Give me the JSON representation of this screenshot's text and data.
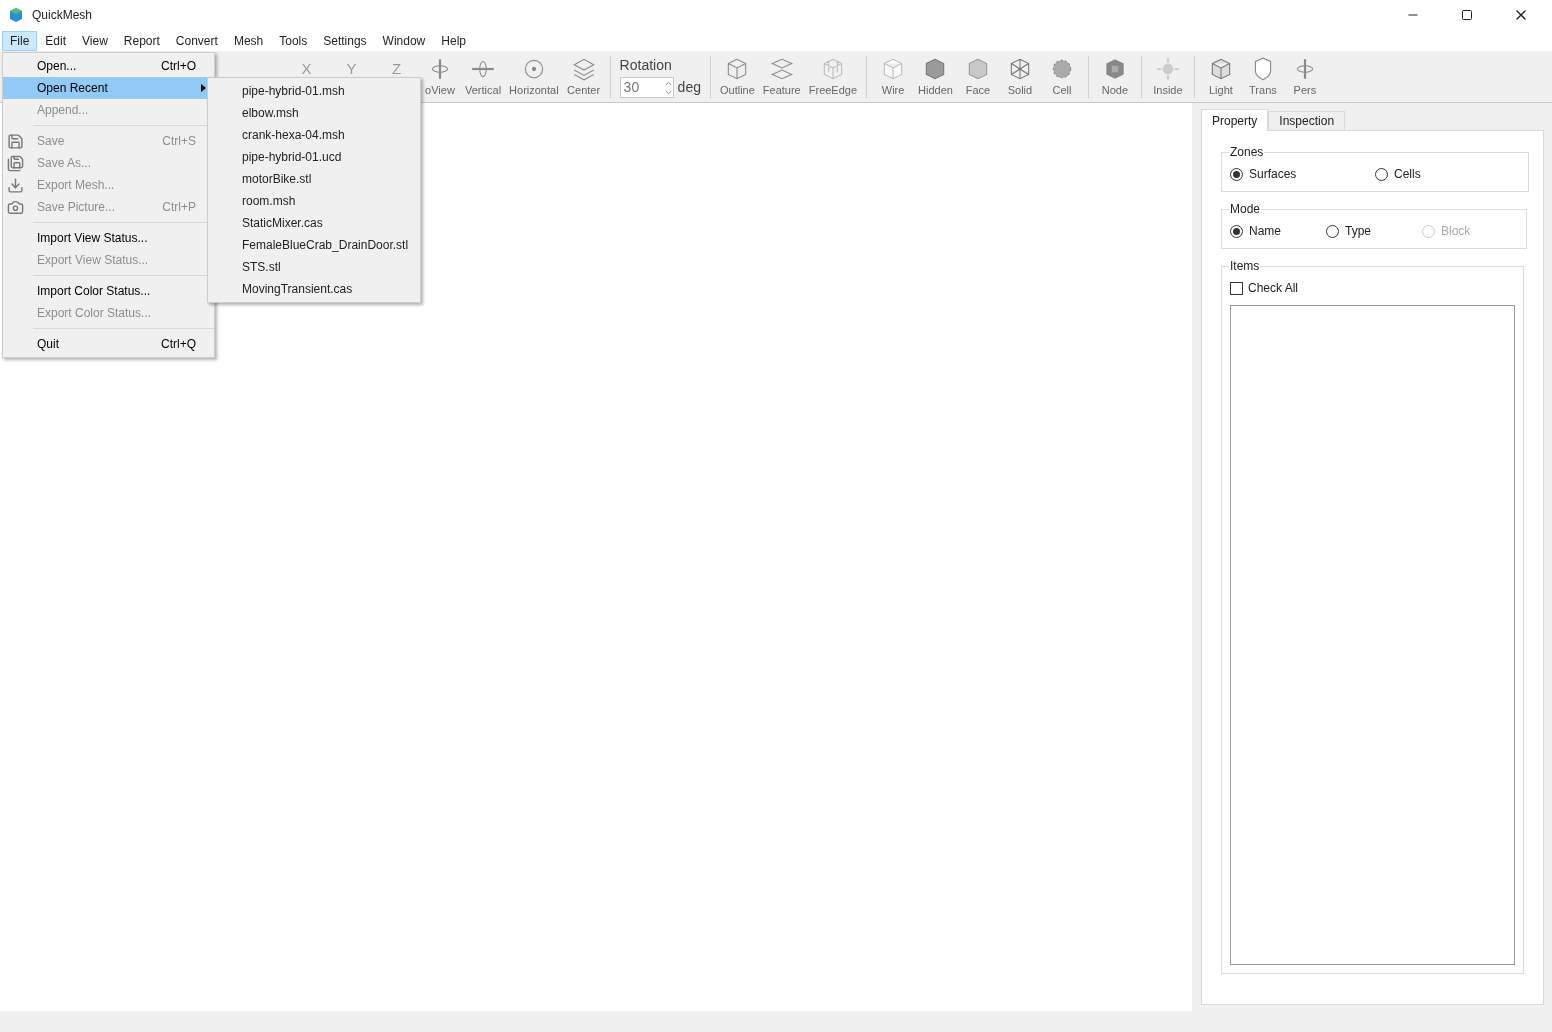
{
  "window": {
    "title": "QuickMesh"
  },
  "menubar": [
    {
      "label": "File",
      "selected": true
    },
    {
      "label": "Edit",
      "selected": false
    },
    {
      "label": "View",
      "selected": false
    },
    {
      "label": "Report",
      "selected": false
    },
    {
      "label": "Convert",
      "selected": false
    },
    {
      "label": "Mesh",
      "selected": false
    },
    {
      "label": "Tools",
      "selected": false
    },
    {
      "label": "Settings",
      "selected": false
    },
    {
      "label": "Window",
      "selected": false
    },
    {
      "label": "Help",
      "selected": false
    }
  ],
  "toolbar": [
    {
      "kind": "axis",
      "label": "X"
    },
    {
      "kind": "axis",
      "label": "Y"
    },
    {
      "kind": "axis",
      "label": "Z"
    },
    {
      "kind": "button",
      "label": "oView"
    },
    {
      "kind": "button",
      "label": "Vertical"
    },
    {
      "kind": "button",
      "label": "Horizontal"
    },
    {
      "kind": "button",
      "label": "Center"
    },
    {
      "kind": "separator"
    },
    {
      "kind": "spin",
      "label": "Rotation",
      "value": "30",
      "unit": "deg"
    },
    {
      "kind": "separator"
    },
    {
      "kind": "button",
      "label": "Outline"
    },
    {
      "kind": "button",
      "label": "Feature"
    },
    {
      "kind": "button",
      "label": "FreeEdge"
    },
    {
      "kind": "separator"
    },
    {
      "kind": "button",
      "label": "Wire"
    },
    {
      "kind": "button",
      "label": "Hidden"
    },
    {
      "kind": "button",
      "label": "Face"
    },
    {
      "kind": "button",
      "label": "Solid"
    },
    {
      "kind": "button",
      "label": "Cell"
    },
    {
      "kind": "separator"
    },
    {
      "kind": "button",
      "label": "Node"
    },
    {
      "kind": "separator"
    },
    {
      "kind": "button",
      "label": "Inside"
    },
    {
      "kind": "separator"
    },
    {
      "kind": "button",
      "label": "Light"
    },
    {
      "kind": "button",
      "label": "Trans"
    },
    {
      "kind": "button",
      "label": "Pers"
    }
  ],
  "file_menu": [
    {
      "kind": "item",
      "label": "Open...",
      "shortcut": "Ctrl+O",
      "disabled": false,
      "selected": false
    },
    {
      "kind": "submenu",
      "label": "Open Recent",
      "disabled": false,
      "selected": true
    },
    {
      "kind": "item",
      "label": "Append...",
      "disabled": true,
      "selected": false
    },
    {
      "kind": "separator"
    },
    {
      "kind": "item",
      "label": "Save",
      "shortcut": "Ctrl+S",
      "disabled": true,
      "selected": false
    },
    {
      "kind": "item",
      "label": "Save As...",
      "disabled": true,
      "selected": false
    },
    {
      "kind": "item",
      "label": "Export Mesh...",
      "disabled": true,
      "selected": false
    },
    {
      "kind": "item",
      "label": "Save Picture...",
      "shortcut": "Ctrl+P",
      "disabled": true,
      "selected": false
    },
    {
      "kind": "separator"
    },
    {
      "kind": "item",
      "label": "Import View Status...",
      "disabled": false,
      "selected": false
    },
    {
      "kind": "item",
      "label": "Export View Status...",
      "disabled": true,
      "selected": false
    },
    {
      "kind": "separator"
    },
    {
      "kind": "item",
      "label": "Import Color Status...",
      "disabled": false,
      "selected": false
    },
    {
      "kind": "item",
      "label": "Export Color Status...",
      "disabled": true,
      "selected": false
    },
    {
      "kind": "separator"
    },
    {
      "kind": "item",
      "label": "Quit",
      "shortcut": "Ctrl+Q",
      "disabled": false,
      "selected": false
    }
  ],
  "recent_files": [
    "pipe-hybrid-01.msh",
    "elbow.msh",
    "crank-hexa-04.msh",
    "pipe-hybrid-01.ucd",
    "motorBike.stl",
    "room.msh",
    "StaticMixer.cas",
    "FemaleBlueCrab_DrainDoor.stl",
    "STS.stl",
    "MovingTransient.cas"
  ],
  "panel": {
    "tabs": [
      {
        "label": "Property",
        "selected": true
      },
      {
        "label": "Inspection",
        "selected": false
      }
    ],
    "groups": [
      {
        "title": "Zones",
        "options": [
          {
            "label": "Surfaces",
            "selected": true,
            "disabled": false
          },
          {
            "label": "Cells",
            "selected": false,
            "disabled": false
          }
        ]
      },
      {
        "title": "Mode",
        "options": [
          {
            "label": "Name",
            "selected": true,
            "disabled": false
          },
          {
            "label": "Type",
            "selected": false,
            "disabled": false
          },
          {
            "label": "Block",
            "selected": false,
            "disabled": true
          }
        ]
      }
    ],
    "items": {
      "title": "Items",
      "check_all": {
        "label": "Check All",
        "checked": false
      }
    }
  }
}
